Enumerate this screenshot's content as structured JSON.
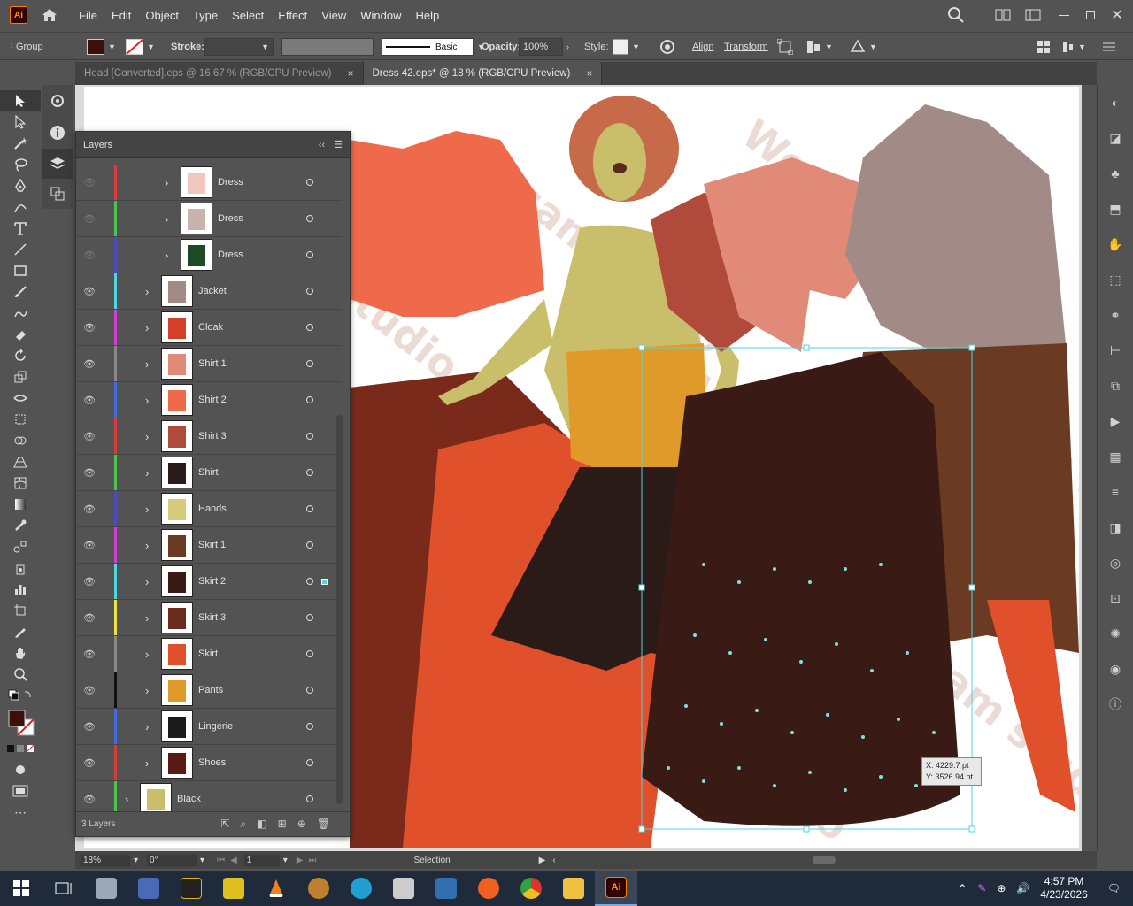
{
  "app": {
    "logo": "Ai",
    "name": "Adobe Illustrator"
  },
  "menu": [
    "File",
    "Edit",
    "Object",
    "Type",
    "Select",
    "Effect",
    "View",
    "Window",
    "Help"
  ],
  "control_bar": {
    "selection_type": "Group",
    "stroke_label": "Stroke:",
    "brush_value": "Basic",
    "opacity_label": "Opacity:",
    "opacity_value": "100%",
    "style_label": "Style:",
    "align_label": "Align",
    "transform_label": "Transform"
  },
  "tabs": [
    {
      "label": "Head [Converted].eps @ 16.67 % (RGB/CPU Preview)",
      "close": "×"
    },
    {
      "label": "Dress 42.eps* @ 18 % (RGB/CPU Preview)",
      "close": "×"
    }
  ],
  "layers_panel": {
    "title": "Layers",
    "footer_count": "3 Layers",
    "rows": [
      {
        "name": "Dress",
        "color": "#e0393e",
        "visible": false,
        "indent": 2,
        "thumb": "#f2c7bd"
      },
      {
        "name": "Dress",
        "color": "#4ec24e",
        "visible": false,
        "indent": 2,
        "thumb": "#c9b3ad"
      },
      {
        "name": "Dress",
        "color": "#4a4ac9",
        "visible": false,
        "indent": 2,
        "thumb": "#1e4a22"
      },
      {
        "name": "Jacket",
        "color": "#4fd6e3",
        "visible": true,
        "indent": 1,
        "thumb": "#a28b87"
      },
      {
        "name": "Cloak",
        "color": "#d43fd0",
        "visible": true,
        "indent": 1,
        "thumb": "#d2402a"
      },
      {
        "name": "Shirt 1",
        "color": "#888888",
        "visible": true,
        "indent": 1,
        "thumb": "#e28a78"
      },
      {
        "name": "Shirt 2",
        "color": "#3d6fe0",
        "visible": true,
        "indent": 1,
        "thumb": "#ee6a4a"
      },
      {
        "name": "Shirt 3",
        "color": "#d93a3a",
        "visible": true,
        "indent": 1,
        "thumb": "#b04a3a"
      },
      {
        "name": "Shirt",
        "color": "#4ec24e",
        "visible": true,
        "indent": 1,
        "thumb": "#2a1a1a"
      },
      {
        "name": "Hands",
        "color": "#4a4ac9",
        "visible": true,
        "indent": 1,
        "thumb": "#d6cd7a"
      },
      {
        "name": "Skirt 1",
        "color": "#d43fd0",
        "visible": true,
        "indent": 1,
        "thumb": "#6b3a22"
      },
      {
        "name": "Skirt 2",
        "color": "#4fd6e3",
        "visible": true,
        "indent": 1,
        "thumb": "#3a1a14"
      },
      {
        "name": "Skirt 3",
        "color": "#f0e040",
        "visible": true,
        "indent": 1,
        "thumb": "#6b2a1a"
      },
      {
        "name": "Skirt",
        "color": "#888888",
        "visible": true,
        "indent": 1,
        "thumb": "#e0502a"
      },
      {
        "name": "Pants",
        "color": "#111111",
        "visible": true,
        "indent": 1,
        "thumb": "#e09a2a"
      },
      {
        "name": "Lingerie",
        "color": "#3d6fe0",
        "visible": true,
        "indent": 1,
        "thumb": "#1a1a1a"
      },
      {
        "name": "Shoes",
        "color": "#d93a3a",
        "visible": true,
        "indent": 1,
        "thumb": "#5a1a14"
      },
      {
        "name": "Black",
        "color": "#4ec24e",
        "visible": true,
        "indent": 0,
        "thumb": "#c9be6a"
      }
    ]
  },
  "status": {
    "zoom": "18%",
    "rotation": "0°",
    "artboard": "1",
    "tool": "Selection"
  },
  "tooltip": {
    "x": "X: 4229.7 pt",
    "y": "Y: 3526.94 pt"
  },
  "watermark": "Wesam studio",
  "taskbar": {
    "time": "4:57 PM",
    "date": "4/23/2026"
  }
}
